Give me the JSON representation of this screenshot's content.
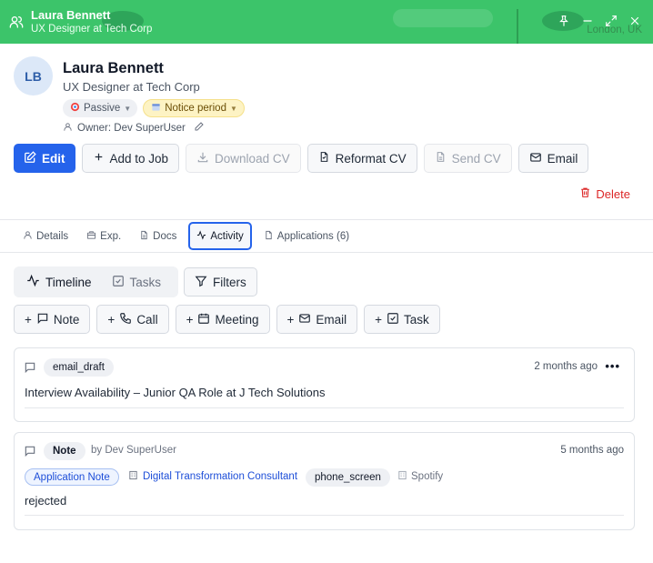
{
  "header": {
    "name": "Laura Bennett",
    "subtitle": "UX Designer at Tech Corp",
    "background_location": "London, UK",
    "colors": {
      "header_bg": "#3cc46a"
    }
  },
  "profile": {
    "initials": "LB",
    "name": "Laura Bennett",
    "title": "UX Designer at Tech Corp",
    "badges": {
      "status": "Passive",
      "availability": "Notice period"
    },
    "owner": "Owner: Dev SuperUser"
  },
  "actions": {
    "edit": "Edit",
    "add_to_job": "Add to Job",
    "download_cv": "Download CV",
    "reformat_cv": "Reformat CV",
    "send_cv": "Send CV",
    "email": "Email",
    "delete": "Delete"
  },
  "tabs": [
    {
      "label": "Details",
      "icon": "user-icon"
    },
    {
      "label": "Exp.",
      "icon": "briefcase-icon"
    },
    {
      "label": "Docs",
      "icon": "document-icon"
    },
    {
      "label": "Activity",
      "icon": "activity-icon",
      "active": true
    },
    {
      "label": "Applications (6)",
      "icon": "file-icon"
    }
  ],
  "activity": {
    "toggle": {
      "timeline": "Timeline",
      "tasks": "Tasks"
    },
    "filters": "Filters",
    "add_buttons": {
      "note": "Note",
      "call": "Call",
      "meeting": "Meeting",
      "email": "Email",
      "task": "Task"
    },
    "items": [
      {
        "type": "email_draft",
        "time": "2 months ago",
        "text": "Interview Availability – Junior QA Role at J Tech Solutions"
      },
      {
        "type": "Note",
        "author": "by Dev SuperUser",
        "time": "5 months ago",
        "app_tag": "Application Note",
        "job": "Digital Transformation Consultant",
        "stage": "phone_screen",
        "company": "Spotify",
        "text": "rejected"
      }
    ]
  }
}
